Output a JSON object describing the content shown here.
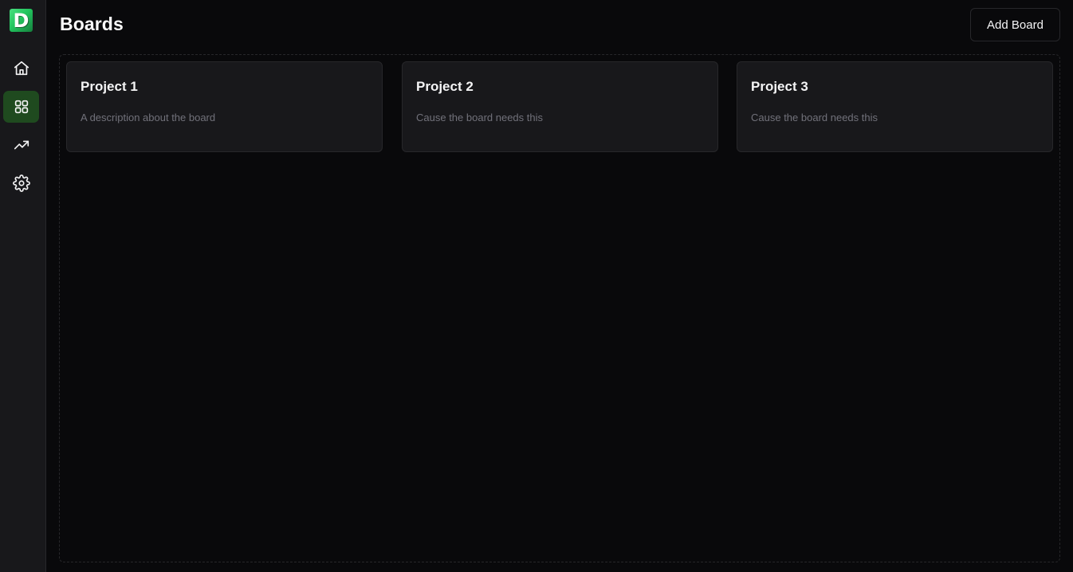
{
  "sidebar": {
    "logo_letter": "D",
    "nav": [
      {
        "icon": "home-icon",
        "active": false
      },
      {
        "icon": "grid-icon",
        "active": true
      },
      {
        "icon": "trending-up-icon",
        "active": false
      },
      {
        "icon": "gear-icon",
        "active": false
      }
    ]
  },
  "header": {
    "title": "Boards",
    "add_button_label": "Add Board"
  },
  "boards": [
    {
      "title": "Project 1",
      "description": "A description about the board"
    },
    {
      "title": "Project 2",
      "description": "Cause the board needs this"
    },
    {
      "title": "Project 3",
      "description": "Cause the board needs this"
    }
  ],
  "colors": {
    "background": "#09090b",
    "sidebar": "#18181b",
    "accent_active": "#1f4a1f",
    "logo_green": "#22c55e",
    "border": "#27272a",
    "muted_text": "#71717a"
  }
}
